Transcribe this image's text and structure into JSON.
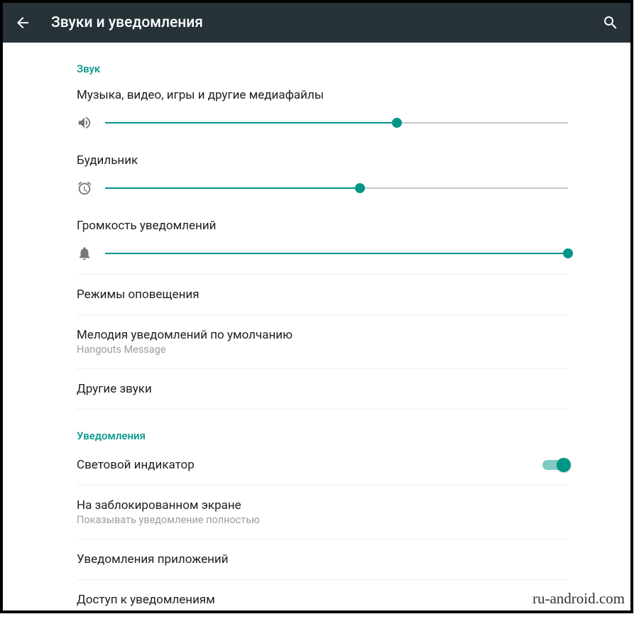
{
  "colors": {
    "accent": "#009688"
  },
  "appbar": {
    "title": "Звуки и уведомления"
  },
  "sections": {
    "sound": {
      "heading": "Звук",
      "sliders": {
        "media": {
          "label": "Музыка, видео, игры и другие медиафайлы",
          "value": 63
        },
        "alarm": {
          "label": "Будильник",
          "value": 55
        },
        "notif": {
          "label": "Громкость уведомлений",
          "value": 100
        }
      },
      "items": {
        "modes": {
          "label": "Режимы оповещения"
        },
        "ringtone": {
          "label": "Мелодия уведомлений по умолчанию",
          "sub": "Hangouts Message"
        },
        "other": {
          "label": "Другие звуки"
        }
      }
    },
    "notifications": {
      "heading": "Уведомления",
      "items": {
        "led": {
          "label": "Световой индикатор",
          "toggle": true
        },
        "lock": {
          "label": "На заблокированном экране",
          "sub": "Показывать уведомление полностью"
        },
        "apps": {
          "label": "Уведомления приложений"
        },
        "access": {
          "label": "Доступ к уведомлениям"
        }
      }
    }
  },
  "watermark": "ru-android.com"
}
